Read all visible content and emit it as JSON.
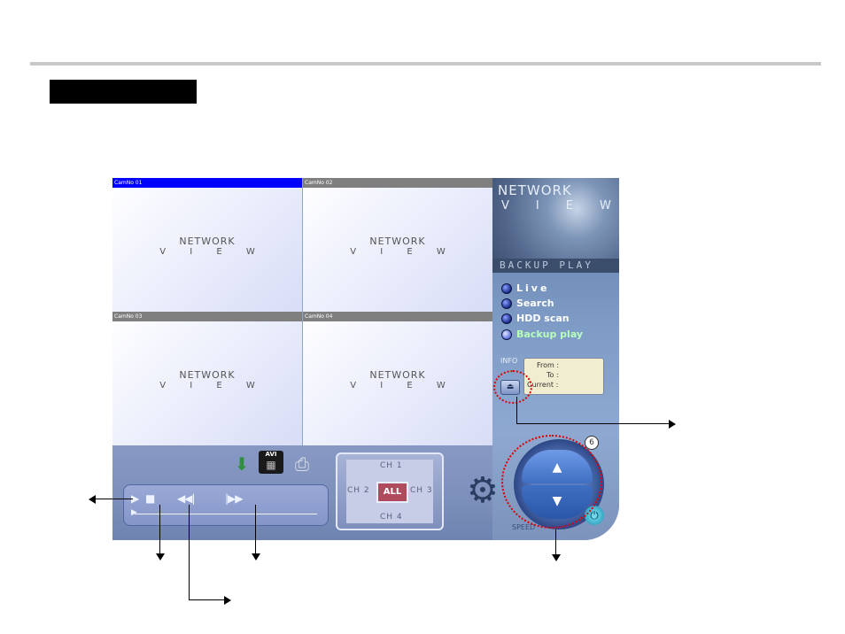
{
  "watermark": {
    "line1": "NETWORK",
    "line2": "V I E W"
  },
  "cameras": [
    {
      "label": "CamNo 01",
      "active": true
    },
    {
      "label": "CamNo 02",
      "active": false
    },
    {
      "label": "CamNo 03",
      "active": false
    },
    {
      "label": "CamNo 04",
      "active": false
    }
  ],
  "side": {
    "logo_line1": "NETWORK",
    "logo_line2": "VIEW",
    "mode_banner": "BACKUP PLAY",
    "menu": [
      {
        "label": "Live"
      },
      {
        "label": "Search"
      },
      {
        "label": "HDD scan"
      },
      {
        "label": "Backup play",
        "selected": true
      }
    ],
    "info_label": "INFO",
    "info_from": "From :",
    "info_to": "To :",
    "info_current": "Current :",
    "eject_icon": "eject-icon"
  },
  "toolbar": {
    "icons": [
      "backup-icon",
      "avi-export-icon",
      "print-icon"
    ],
    "avi_label": "AVI"
  },
  "playback": {
    "play": "▶",
    "stop": "■",
    "step_back": "◀◀|",
    "step_fwd": "|▶▶"
  },
  "channels": {
    "ch1": "CH 1",
    "ch2": "CH 2",
    "ch3": "CH 3",
    "ch4": "CH 4",
    "all": "ALL"
  },
  "speed": {
    "up": "▲",
    "down": "▼",
    "label": "SPEED",
    "badge": "6",
    "power_icon": "power-icon"
  },
  "colors": {
    "active_cam_header": "#0000ff",
    "inactive_cam_header": "#7f7f7f",
    "annotation_red": "#e00000",
    "selected_menu_text": "#b8ffb8"
  }
}
